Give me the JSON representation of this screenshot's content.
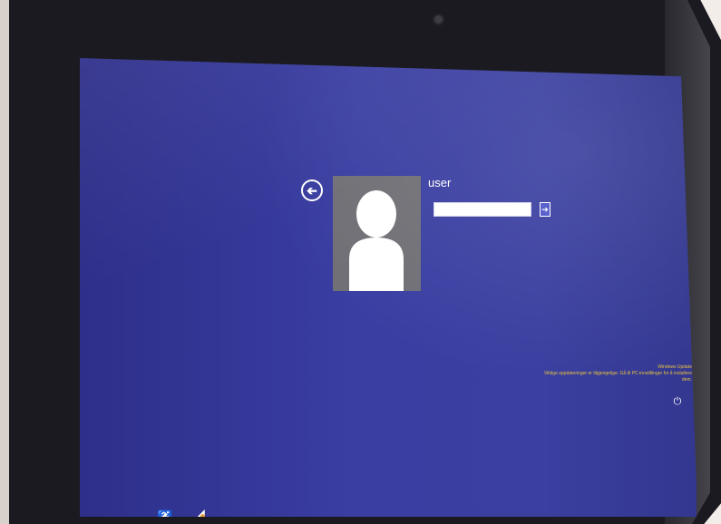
{
  "lock_screen": {
    "username": "user",
    "password_value": "",
    "back_glyph": "➔",
    "submit_glyph": "➔",
    "colors": {
      "background": "#3a3ea2",
      "avatar_tile": "#6f6f75",
      "notice_text": "#e9c23e",
      "submit_button": "#4d55c8"
    }
  },
  "windows_update": {
    "title": "Windows Update",
    "message": "Viktige oppdateringer er tilgjengelige. Gå til PC-innstillinger for å installere dem."
  },
  "icons": {
    "back": "back-arrow-icon",
    "avatar": "user-silhouette-icon",
    "power": "power-icon",
    "ease_of_access": "ease-of-access-icon",
    "network": "network-icon"
  }
}
